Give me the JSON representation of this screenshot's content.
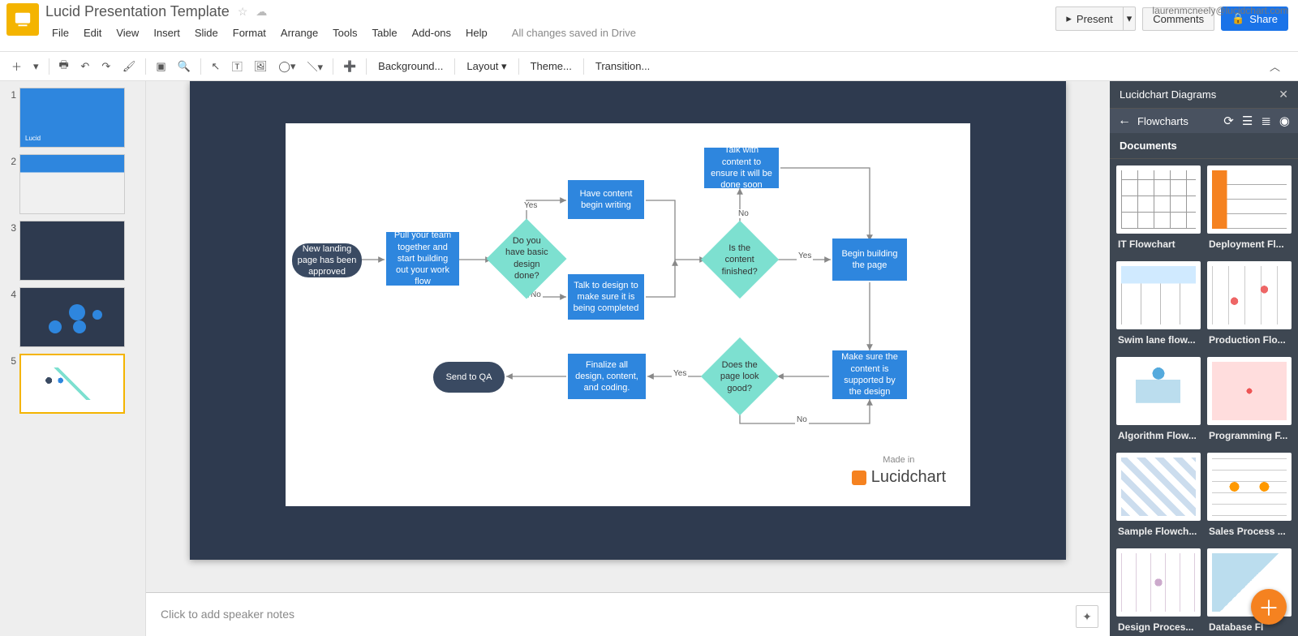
{
  "header": {
    "doc_title": "Lucid Presentation Template",
    "menus": [
      "File",
      "Edit",
      "View",
      "Insert",
      "Slide",
      "Format",
      "Arrange",
      "Tools",
      "Table",
      "Add-ons",
      "Help"
    ],
    "save_status": "All changes saved in Drive",
    "user_email": "laurenmcneely@lucidchart.com",
    "present_label": "Present",
    "comments_label": "Comments",
    "share_label": "Share"
  },
  "toolbar": {
    "background_label": "Background...",
    "layout_label": "Layout",
    "theme_label": "Theme...",
    "transition_label": "Transition..."
  },
  "slides": {
    "count": 5,
    "selected": 5
  },
  "flowchart": {
    "nodes": {
      "start": "New landing page has been approved",
      "pull_team": "Pull your team together and start building out your work flow",
      "design_done": "Do you have basic design done?",
      "have_content": "Have content begin writing",
      "talk_design": "Talk to design to make sure it is being completed",
      "content_finished": "Is the content finished?",
      "talk_content": "Talk with content to ensure it will be done soon",
      "begin_build": "Begin building the page",
      "supported": "Make sure the content is supported by the design",
      "looks_good": "Does the page look good?",
      "finalize": "Finalize all design, content, and coding.",
      "send_qa": "Send to QA"
    },
    "edge_labels": {
      "yes": "Yes",
      "no": "No"
    },
    "made_in": "Made in",
    "lucidchart": "Lucidchart"
  },
  "notes": {
    "placeholder": "Click to add speaker notes"
  },
  "sidebar": {
    "title": "Lucidchart Diagrams",
    "breadcrumb": "Flowcharts",
    "section": "Documents",
    "docs": [
      "IT Flowchart",
      "Deployment Fl...",
      "Swim lane flow...",
      "Production Flo...",
      "Algorithm Flow...",
      "Programming F...",
      "Sample Flowch...",
      "Sales Process ...",
      "Design Proces...",
      "Database Fl"
    ]
  }
}
